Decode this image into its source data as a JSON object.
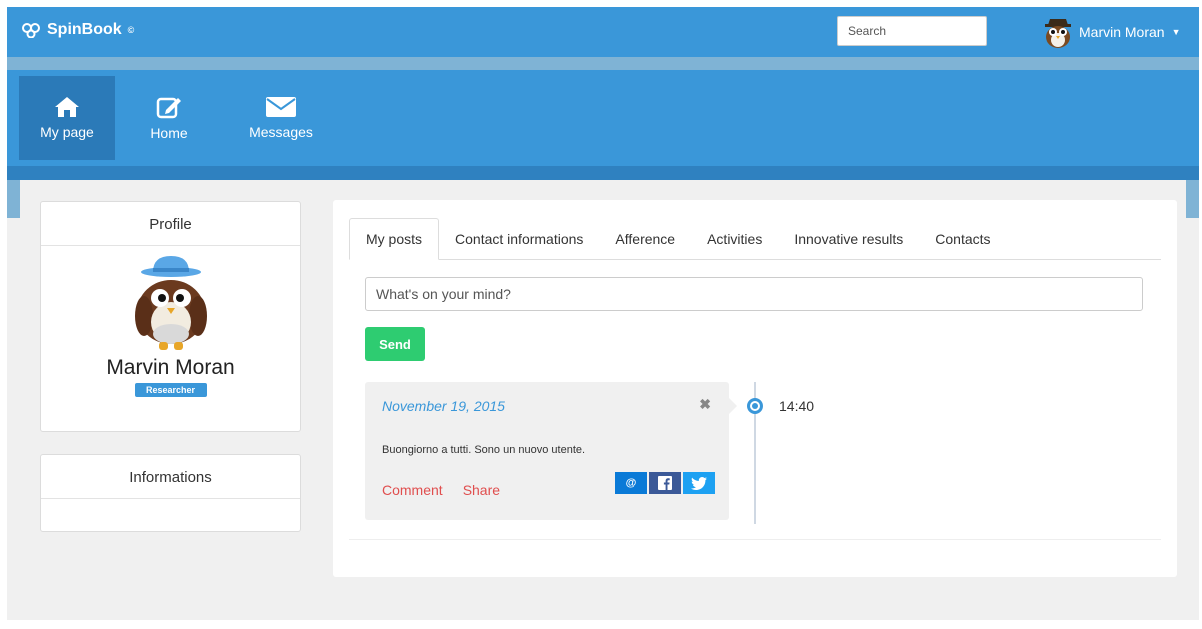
{
  "brand": {
    "name": "SpinBook",
    "mark": "©"
  },
  "search": {
    "placeholder": "Search"
  },
  "user": {
    "name": "Marvin Moran"
  },
  "nav": [
    {
      "label": "My page",
      "icon": "home-icon",
      "active": true
    },
    {
      "label": "Home",
      "icon": "edit-icon",
      "active": false
    },
    {
      "label": "Messages",
      "icon": "envelope-icon",
      "active": false
    }
  ],
  "profile": {
    "title": "Profile",
    "name": "Marvin Moran",
    "role": "Researcher"
  },
  "informations": {
    "title": "Informations"
  },
  "tabs": [
    "My posts",
    "Contact informations",
    "Afference",
    "Activities",
    "Innovative results",
    "Contacts"
  ],
  "composer": {
    "placeholder": "What's on your mind?",
    "send_label": "Send"
  },
  "post": {
    "date": "November 19, 2015",
    "close": "✖",
    "text": "Buongiorno a tutti. Sono un nuovo utente.",
    "comment": "Comment",
    "share": "Share",
    "time": "14:40",
    "share_icons": [
      "@",
      "f",
      "t"
    ]
  },
  "colors": {
    "primary": "#3a97d9",
    "active_nav": "#2b7ab8",
    "send": "#2ecc71",
    "action": "#e04e4e"
  }
}
